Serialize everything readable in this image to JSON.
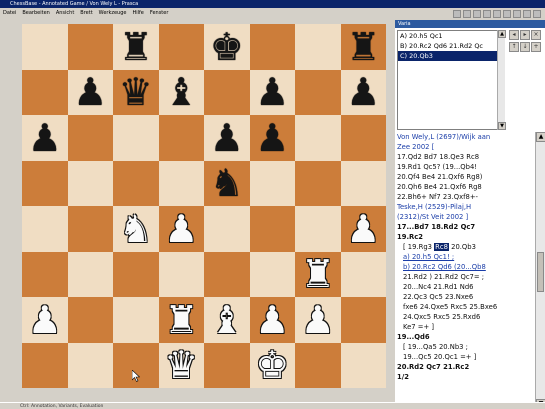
{
  "window": {
    "title": "ChessBase - Annotated Game / Von Wely L - Prasca"
  },
  "menu": [
    "Datei",
    "Bearbeiten",
    "Ansicht",
    "Brett",
    "Werkzeuge",
    "Hilfe",
    "Fenster"
  ],
  "toolbar_icons": [
    "new-icon",
    "open-icon",
    "save-icon",
    "print-icon",
    "back-icon",
    "forward-icon",
    "flip-icon",
    "engine-icon",
    "help-icon"
  ],
  "board": {
    "light_color": "#f0ddc3",
    "dark_color": "#cc7d3a",
    "ranks": [
      [
        "",
        "",
        "bR",
        "",
        "bK",
        "",
        "",
        "bR"
      ],
      [
        "",
        "bP",
        "bQ",
        "bB",
        "",
        "bP",
        "",
        "bP"
      ],
      [
        "bP",
        "",
        "",
        "",
        "bP",
        "bP",
        "",
        ""
      ],
      [
        "",
        "",
        "",
        "",
        "bN",
        "",
        "",
        ""
      ],
      [
        "",
        "",
        "wN",
        "wP",
        "",
        "",
        "",
        "wP"
      ],
      [
        "",
        "",
        "",
        "",
        "",
        "",
        "wR",
        ""
      ],
      [
        "wP",
        "",
        "",
        "wR",
        "wB",
        "wP",
        "wP",
        ""
      ],
      [
        "",
        "",
        "",
        "wQ",
        "",
        "wK",
        "",
        ""
      ]
    ]
  },
  "variations": {
    "header": "Varia",
    "items": [
      {
        "label": "A) 20.h5 Qc1",
        "selected": false
      },
      {
        "label": "B) 20.Rc2 Qd6 21.Rd2 Qc",
        "selected": false
      },
      {
        "label": "C) 20.Qb3",
        "selected": true
      }
    ]
  },
  "notation": {
    "lines": [
      {
        "text": "Von Wely,L (2697)/Wijk aan",
        "cls": "blue"
      },
      {
        "text": "Zee 2002 [",
        "cls": "blue"
      },
      {
        "text": "17.Qd2 Bd7 18.Qe3 Rc8",
        "cls": ""
      },
      {
        "text": "19.Rd1 Qc5? (19...Qb4!",
        "cls": ""
      },
      {
        "text": "20.Qf4 Be4 21.Qxf6 Rg8)",
        "cls": ""
      },
      {
        "text": "20.Qh6 Be4 21.Qxf6 Rg8",
        "cls": ""
      },
      {
        "text": "22.Bh6+ Nf7 23.Qxf8+-",
        "cls": ""
      },
      {
        "text": "Teske,H (2529)-Pilaj,H",
        "cls": "blue"
      },
      {
        "text": "(2312)/St Veit 2002 ]",
        "cls": "blue"
      },
      {
        "text": "17...Bd7 18.Rd2 Qc7",
        "cls": "bold"
      },
      {
        "text": "19.Rc2",
        "cls": "bold"
      },
      {
        "text": "[ 19.Rg3 Rc8 20.Qb3",
        "cls": "ind",
        "hl": "Rc8"
      },
      {
        "text": "a) 20.h5 Qc1! ;",
        "cls": "ind blue ul"
      },
      {
        "text": "b) 20.Rc2 Qd6 (20...Qb8",
        "cls": "ind blue ul"
      },
      {
        "text": "21.Rd2 ) 21.Rd2 Qc7= ;",
        "cls": "ind"
      },
      {
        "text": "20...Nc4 21.Rd1 Nd6",
        "cls": "ind"
      },
      {
        "text": "22.Qc3 Qc5 23.Nxe6",
        "cls": "ind"
      },
      {
        "text": "fxe6 24.Qxe5 Rxc5 25.Bxe6",
        "cls": "ind"
      },
      {
        "text": "24.Qxc5 Rxc5 25.Rxd6",
        "cls": "ind"
      },
      {
        "text": "Ke7 =+ ]",
        "cls": "ind"
      },
      {
        "text": "19...Qd6",
        "cls": "bold"
      },
      {
        "text": "[ 19...Qa5 20.Nb3 ;",
        "cls": "ind"
      },
      {
        "text": "19...Qc5 20.Qc1 =+ ]",
        "cls": "ind"
      },
      {
        "text": "20.Rd2 Qc7 21.Rc2",
        "cls": "bold"
      },
      {
        "text": "1/2",
        "cls": "bold"
      }
    ]
  },
  "status": {
    "text": "Ctrl: Annotation, Variants, Evaluation"
  }
}
